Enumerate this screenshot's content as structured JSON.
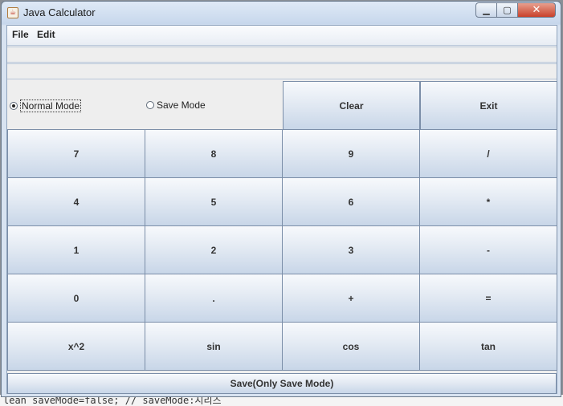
{
  "window": {
    "title": "Java Calculator",
    "controls": {
      "minimize": "▭",
      "maximize": "▢",
      "close": "✕"
    }
  },
  "menu": {
    "items": [
      "File",
      "Edit"
    ]
  },
  "display": {
    "line1": "",
    "line2": ""
  },
  "modes": {
    "normal": {
      "label": "Normal Mode",
      "selected": true
    },
    "save": {
      "label": "Save Mode",
      "selected": false
    }
  },
  "buttons": {
    "clear": "Clear",
    "exit": "Exit",
    "rows": [
      [
        "7",
        "8",
        "9",
        "/"
      ],
      [
        "4",
        "5",
        "6",
        "*"
      ],
      [
        "1",
        "2",
        "3",
        "-"
      ],
      [
        "0",
        ".",
        "+",
        "="
      ],
      [
        "x^2",
        "sin",
        "cos",
        "tan"
      ]
    ],
    "save": "Save(Only Save Mode)"
  },
  "background_code": "lean saveMode=false; // saveMode:시리즈"
}
